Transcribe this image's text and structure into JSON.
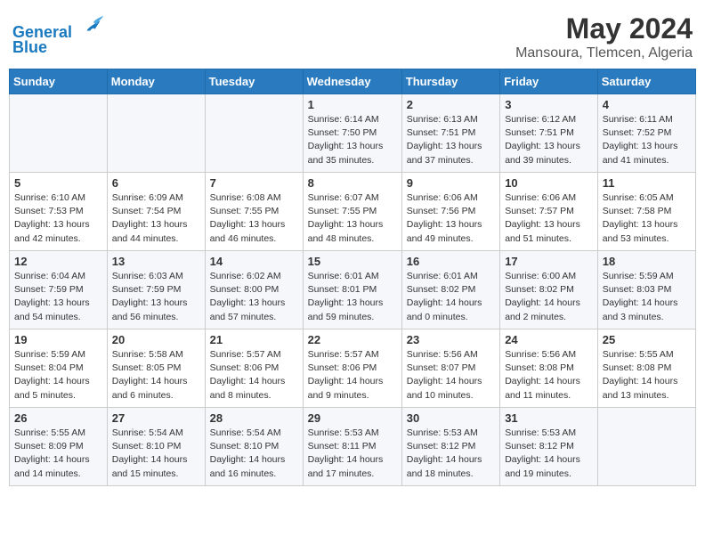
{
  "header": {
    "logo_line1": "General",
    "logo_line2": "Blue",
    "month_year": "May 2024",
    "location": "Mansoura, Tlemcen, Algeria"
  },
  "days_of_week": [
    "Sunday",
    "Monday",
    "Tuesday",
    "Wednesday",
    "Thursday",
    "Friday",
    "Saturday"
  ],
  "weeks": [
    [
      {
        "day": "",
        "sunrise": "",
        "sunset": "",
        "daylight": ""
      },
      {
        "day": "",
        "sunrise": "",
        "sunset": "",
        "daylight": ""
      },
      {
        "day": "",
        "sunrise": "",
        "sunset": "",
        "daylight": ""
      },
      {
        "day": "1",
        "sunrise": "Sunrise: 6:14 AM",
        "sunset": "Sunset: 7:50 PM",
        "daylight": "Daylight: 13 hours and 35 minutes."
      },
      {
        "day": "2",
        "sunrise": "Sunrise: 6:13 AM",
        "sunset": "Sunset: 7:51 PM",
        "daylight": "Daylight: 13 hours and 37 minutes."
      },
      {
        "day": "3",
        "sunrise": "Sunrise: 6:12 AM",
        "sunset": "Sunset: 7:51 PM",
        "daylight": "Daylight: 13 hours and 39 minutes."
      },
      {
        "day": "4",
        "sunrise": "Sunrise: 6:11 AM",
        "sunset": "Sunset: 7:52 PM",
        "daylight": "Daylight: 13 hours and 41 minutes."
      }
    ],
    [
      {
        "day": "5",
        "sunrise": "Sunrise: 6:10 AM",
        "sunset": "Sunset: 7:53 PM",
        "daylight": "Daylight: 13 hours and 42 minutes."
      },
      {
        "day": "6",
        "sunrise": "Sunrise: 6:09 AM",
        "sunset": "Sunset: 7:54 PM",
        "daylight": "Daylight: 13 hours and 44 minutes."
      },
      {
        "day": "7",
        "sunrise": "Sunrise: 6:08 AM",
        "sunset": "Sunset: 7:55 PM",
        "daylight": "Daylight: 13 hours and 46 minutes."
      },
      {
        "day": "8",
        "sunrise": "Sunrise: 6:07 AM",
        "sunset": "Sunset: 7:55 PM",
        "daylight": "Daylight: 13 hours and 48 minutes."
      },
      {
        "day": "9",
        "sunrise": "Sunrise: 6:06 AM",
        "sunset": "Sunset: 7:56 PM",
        "daylight": "Daylight: 13 hours and 49 minutes."
      },
      {
        "day": "10",
        "sunrise": "Sunrise: 6:06 AM",
        "sunset": "Sunset: 7:57 PM",
        "daylight": "Daylight: 13 hours and 51 minutes."
      },
      {
        "day": "11",
        "sunrise": "Sunrise: 6:05 AM",
        "sunset": "Sunset: 7:58 PM",
        "daylight": "Daylight: 13 hours and 53 minutes."
      }
    ],
    [
      {
        "day": "12",
        "sunrise": "Sunrise: 6:04 AM",
        "sunset": "Sunset: 7:59 PM",
        "daylight": "Daylight: 13 hours and 54 minutes."
      },
      {
        "day": "13",
        "sunrise": "Sunrise: 6:03 AM",
        "sunset": "Sunset: 7:59 PM",
        "daylight": "Daylight: 13 hours and 56 minutes."
      },
      {
        "day": "14",
        "sunrise": "Sunrise: 6:02 AM",
        "sunset": "Sunset: 8:00 PM",
        "daylight": "Daylight: 13 hours and 57 minutes."
      },
      {
        "day": "15",
        "sunrise": "Sunrise: 6:01 AM",
        "sunset": "Sunset: 8:01 PM",
        "daylight": "Daylight: 13 hours and 59 minutes."
      },
      {
        "day": "16",
        "sunrise": "Sunrise: 6:01 AM",
        "sunset": "Sunset: 8:02 PM",
        "daylight": "Daylight: 14 hours and 0 minutes."
      },
      {
        "day": "17",
        "sunrise": "Sunrise: 6:00 AM",
        "sunset": "Sunset: 8:02 PM",
        "daylight": "Daylight: 14 hours and 2 minutes."
      },
      {
        "day": "18",
        "sunrise": "Sunrise: 5:59 AM",
        "sunset": "Sunset: 8:03 PM",
        "daylight": "Daylight: 14 hours and 3 minutes."
      }
    ],
    [
      {
        "day": "19",
        "sunrise": "Sunrise: 5:59 AM",
        "sunset": "Sunset: 8:04 PM",
        "daylight": "Daylight: 14 hours and 5 minutes."
      },
      {
        "day": "20",
        "sunrise": "Sunrise: 5:58 AM",
        "sunset": "Sunset: 8:05 PM",
        "daylight": "Daylight: 14 hours and 6 minutes."
      },
      {
        "day": "21",
        "sunrise": "Sunrise: 5:57 AM",
        "sunset": "Sunset: 8:06 PM",
        "daylight": "Daylight: 14 hours and 8 minutes."
      },
      {
        "day": "22",
        "sunrise": "Sunrise: 5:57 AM",
        "sunset": "Sunset: 8:06 PM",
        "daylight": "Daylight: 14 hours and 9 minutes."
      },
      {
        "day": "23",
        "sunrise": "Sunrise: 5:56 AM",
        "sunset": "Sunset: 8:07 PM",
        "daylight": "Daylight: 14 hours and 10 minutes."
      },
      {
        "day": "24",
        "sunrise": "Sunrise: 5:56 AM",
        "sunset": "Sunset: 8:08 PM",
        "daylight": "Daylight: 14 hours and 11 minutes."
      },
      {
        "day": "25",
        "sunrise": "Sunrise: 5:55 AM",
        "sunset": "Sunset: 8:08 PM",
        "daylight": "Daylight: 14 hours and 13 minutes."
      }
    ],
    [
      {
        "day": "26",
        "sunrise": "Sunrise: 5:55 AM",
        "sunset": "Sunset: 8:09 PM",
        "daylight": "Daylight: 14 hours and 14 minutes."
      },
      {
        "day": "27",
        "sunrise": "Sunrise: 5:54 AM",
        "sunset": "Sunset: 8:10 PM",
        "daylight": "Daylight: 14 hours and 15 minutes."
      },
      {
        "day": "28",
        "sunrise": "Sunrise: 5:54 AM",
        "sunset": "Sunset: 8:10 PM",
        "daylight": "Daylight: 14 hours and 16 minutes."
      },
      {
        "day": "29",
        "sunrise": "Sunrise: 5:53 AM",
        "sunset": "Sunset: 8:11 PM",
        "daylight": "Daylight: 14 hours and 17 minutes."
      },
      {
        "day": "30",
        "sunrise": "Sunrise: 5:53 AM",
        "sunset": "Sunset: 8:12 PM",
        "daylight": "Daylight: 14 hours and 18 minutes."
      },
      {
        "day": "31",
        "sunrise": "Sunrise: 5:53 AM",
        "sunset": "Sunset: 8:12 PM",
        "daylight": "Daylight: 14 hours and 19 minutes."
      },
      {
        "day": "",
        "sunrise": "",
        "sunset": "",
        "daylight": ""
      }
    ]
  ]
}
